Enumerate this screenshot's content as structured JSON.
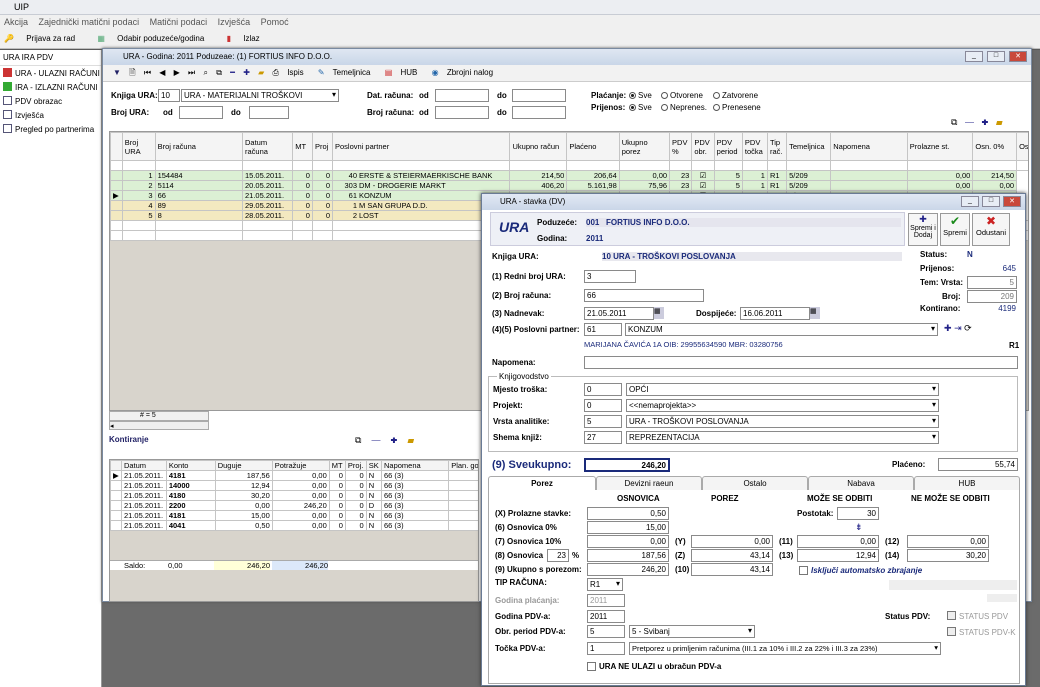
{
  "app_title": "UIP",
  "menu": [
    "Akcija",
    "Zajednički matični podaci",
    "Matični podaci",
    "Izvješća",
    "Pomoć"
  ],
  "toolbar": {
    "login": "Prijava za rad",
    "choose": "Odabir poduzeće/godina",
    "exit": "Izlaz"
  },
  "sidebar": {
    "header": "URA IRA PDV",
    "items": [
      "URA - ULAZNI RAČUNI",
      "IRA - IZLAZNI RAČUNI",
      "PDV obrazac",
      "Izvješća",
      "Pregled po partnerima"
    ]
  },
  "win1": {
    "title": "URA - Godina: 2011   Poduzeae: (1) FORTIUS INFO D.O.O.",
    "tb": {
      "print": "Ispis",
      "temeljnica": "Temeljnica",
      "hub": "HUB",
      "zbrojni": "Zbrojni nalog"
    },
    "knjiga_label": "Knjiga URA:",
    "knjiga_no": "10",
    "knjiga_name": "URA - MATERIJALNI TROŠKOVI",
    "broj_ura_label": "Broj URA:",
    "od": "od",
    "do": "do",
    "dat_label": "Dat. računa:",
    "brojr_label": "Broj računa:",
    "placanje_label": "Plaćanje:",
    "prijenos_label": "Prijenos:",
    "opt_sve": "Sve",
    "opt_otvorene": "Otvorene",
    "opt_zatvorene": "Zatvorene",
    "opt_neprenes": "Neprenes.",
    "opt_prenesene": "Prenesene",
    "columns": [
      "Broj URA",
      "Broj računa",
      "Datum računa",
      "MT",
      "Proj",
      "Poslovni partner",
      "Ukupno račun",
      "Plaćeno",
      "Ukupno porez",
      "PDV %",
      "PDV obr.",
      "PDV period",
      "PDV točka",
      "Tip rač.",
      "Temeljnica",
      "Napomena",
      "Prolazne st.",
      "Osn. 0%",
      "Osn."
    ],
    "rows": [
      [
        "1",
        "154484",
        "15.05.2011.",
        "0",
        "0",
        "40",
        "ERSTE & STEIERMAERKISCHE BANK",
        "214,50",
        "206,64",
        "0,00",
        "23",
        "",
        "5",
        "1",
        "R1",
        "5/209",
        "",
        "0,00",
        "214,50"
      ],
      [
        "2",
        "5114",
        "20.05.2011.",
        "0",
        "0",
        "303",
        "DM - DROGERIE MARKT",
        "406,20",
        "5.161,98",
        "75,96",
        "23",
        "",
        "5",
        "1",
        "R1",
        "5/209",
        "",
        "0,00",
        "0,00"
      ],
      [
        "3",
        "66",
        "21.05.2011.",
        "0",
        "0",
        "61",
        "KONZUM",
        "246,20",
        "55,74",
        "43,14",
        "23",
        "",
        "5",
        "1",
        "R1",
        "5/209",
        "",
        "0,50",
        "15,00"
      ],
      [
        "4",
        "89",
        "29.05.2011.",
        "0",
        "0",
        "1",
        "M SAN GRUPA D.D.",
        "",
        "",
        "",
        "",
        "",
        "",
        "",
        "",
        "",
        "",
        "",
        ""
      ],
      [
        "5",
        "8",
        "28.05.2011.",
        "0",
        "0",
        "2",
        "LOST",
        "",
        "",
        "",
        "",
        "",
        "",
        "",
        "",
        "",
        "",
        "",
        ""
      ]
    ],
    "count": "# = 5",
    "kontiranje": "Kontiranje",
    "k_columns": [
      "Datum",
      "Konto",
      "Duguje",
      "Potražuje",
      "MT",
      "Proj.",
      "SK",
      "Napomena",
      "Plan. go"
    ],
    "k_rows": [
      [
        "21.05.2011.",
        "4181",
        "187,56",
        "0,00",
        "0",
        "0",
        "N",
        "66 (3)"
      ],
      [
        "21.05.2011.",
        "14000",
        "12,94",
        "0,00",
        "0",
        "0",
        "N",
        "66 (3)"
      ],
      [
        "21.05.2011.",
        "4180",
        "30,20",
        "0,00",
        "0",
        "0",
        "N",
        "66 (3)"
      ],
      [
        "21.05.2011.",
        "2200",
        "0,00",
        "246,20",
        "0",
        "0",
        "D",
        "66 (3)"
      ],
      [
        "21.05.2011.",
        "4181",
        "15,00",
        "0,00",
        "0",
        "0",
        "N",
        "66 (3)"
      ],
      [
        "21.05.2011.",
        "4041",
        "0,50",
        "0,00",
        "0",
        "0",
        "N",
        "66 (3)"
      ]
    ],
    "saldo_label": "Saldo:",
    "saldo": "0,00",
    "saldo_dug": "246,20",
    "saldo_pot": "246,20"
  },
  "win2": {
    "title": "URA - stavka (DV)",
    "logo": "URA",
    "poduzece_label": "Poduzeće:",
    "poduzece_no": "001",
    "poduzece_name": "FORTIUS INFO D.O.O.",
    "godina_label": "Godina:",
    "godina": "2011",
    "btn_save_add": "Spremi i Dodaj",
    "btn_save": "Spremi",
    "btn_cancel": "Odustani",
    "knjiga_label": "Knjiga URA:",
    "knjiga": "10  URA - TROŠKOVI POSLOVANJA",
    "status_label": "Status:",
    "status": "N",
    "prijenos_label": "Prijenos:",
    "prijenos": "645",
    "tem_label": "Tem: Vrsta:",
    "tem_vrsta": "5",
    "broj_label": "Broj:",
    "broj": "209",
    "kontirano_label": "Kontirano:",
    "kontirano": "4199",
    "l1": "(1) Redni broj URA:",
    "v1": "3",
    "l2": "(2) Broj računa:",
    "v2": "66",
    "l3": "(3) Nadnevak:",
    "v3": "21.05.2011",
    "dospijece_label": "Dospijeće:",
    "dospijece": "16.06.2011",
    "l45": "(4)(5) Poslovni partner:",
    "partner_no": "61",
    "partner": "KONZUM",
    "partner_info": "MARIJANA ČAVIĆA 1A  OIB: 29955634590  MBR: 03280756",
    "r1": "R1",
    "napomena_label": "Napomena:",
    "knjig_label": "Knjigovodstvo",
    "mt_label": "Mjesto troška:",
    "mt_no": "0",
    "mt": "OPĆI",
    "proj_label": "Projekt:",
    "proj_no": "0",
    "proj": "<<nemaprojekta>>",
    "va_label": "Vrsta analitike:",
    "va_no": "5",
    "va": "URA - TROŠKOVI POSLOVANJA",
    "sk_label": "Shema knjiž:",
    "sk_no": "27",
    "sk": "REPREZENTACIJA",
    "sveukupno_label": "(9) Sveukupno:",
    "sveukupno": "246,20",
    "placeno_label": "Plaćeno:",
    "placeno": "55,74",
    "tabs": [
      "Porez",
      "Devizni raeun",
      "Ostalo",
      "Nabava",
      "HUB"
    ],
    "h_osnovica": "OSNOVICA",
    "h_porez": "POREZ",
    "h_moze": "MOŽE SE ODBITI",
    "h_nemoze": "NE MOŽE SE ODBITI",
    "lx": "(X) Prolazne stavke:",
    "vx": "0,50",
    "l6": "(6) Osnovica 0%",
    "v6": "15,00",
    "l7": "(7) Osnovica 10%",
    "v7": "0,00",
    "ly": "(Y)",
    "vy": "0,00",
    "l11": "(11)",
    "v11": "0,00",
    "l12": "(12)",
    "v12": "0,00",
    "l8": "(8) Osnovica",
    "pct": "23",
    "pctsign": "%",
    "v8": "187,56",
    "lz": "(Z)",
    "vz": "43,14",
    "l13": "(13)",
    "v13": "12,94",
    "l14": "(14)",
    "v14": "30,20",
    "l9": "(9) Ukupno s porezom:",
    "v9": "246,20",
    "l10": "(10)",
    "v10": "43,14",
    "postotak_label": "Postotak:",
    "postotak": "30",
    "iskljuci": "Isključi automatsko zbrajanje",
    "tip_label": "TIP RAČUNA:",
    "tip": "R1",
    "gp_label": "Godina plaćanja:",
    "gp": "2011",
    "gpdv_label": "Godina PDV-a:",
    "gpdv": "2011",
    "op_label": "Obr. period PDV-a:",
    "op_no": "5",
    "op": "5 - Svibanj",
    "tp_label": "Točka PDV-a:",
    "tp_no": "1",
    "tp": "Pretporez u primljenim računima (III.1 za 10% i III.2 za 22% i III.3 za 23%)",
    "status_pdv_label": "Status PDV:",
    "sp1": "STATUS PDV",
    "sp2": "STATUS PDV-K",
    "ne_ulazi": "URA NE ULAZI u obračun PDV-a"
  }
}
